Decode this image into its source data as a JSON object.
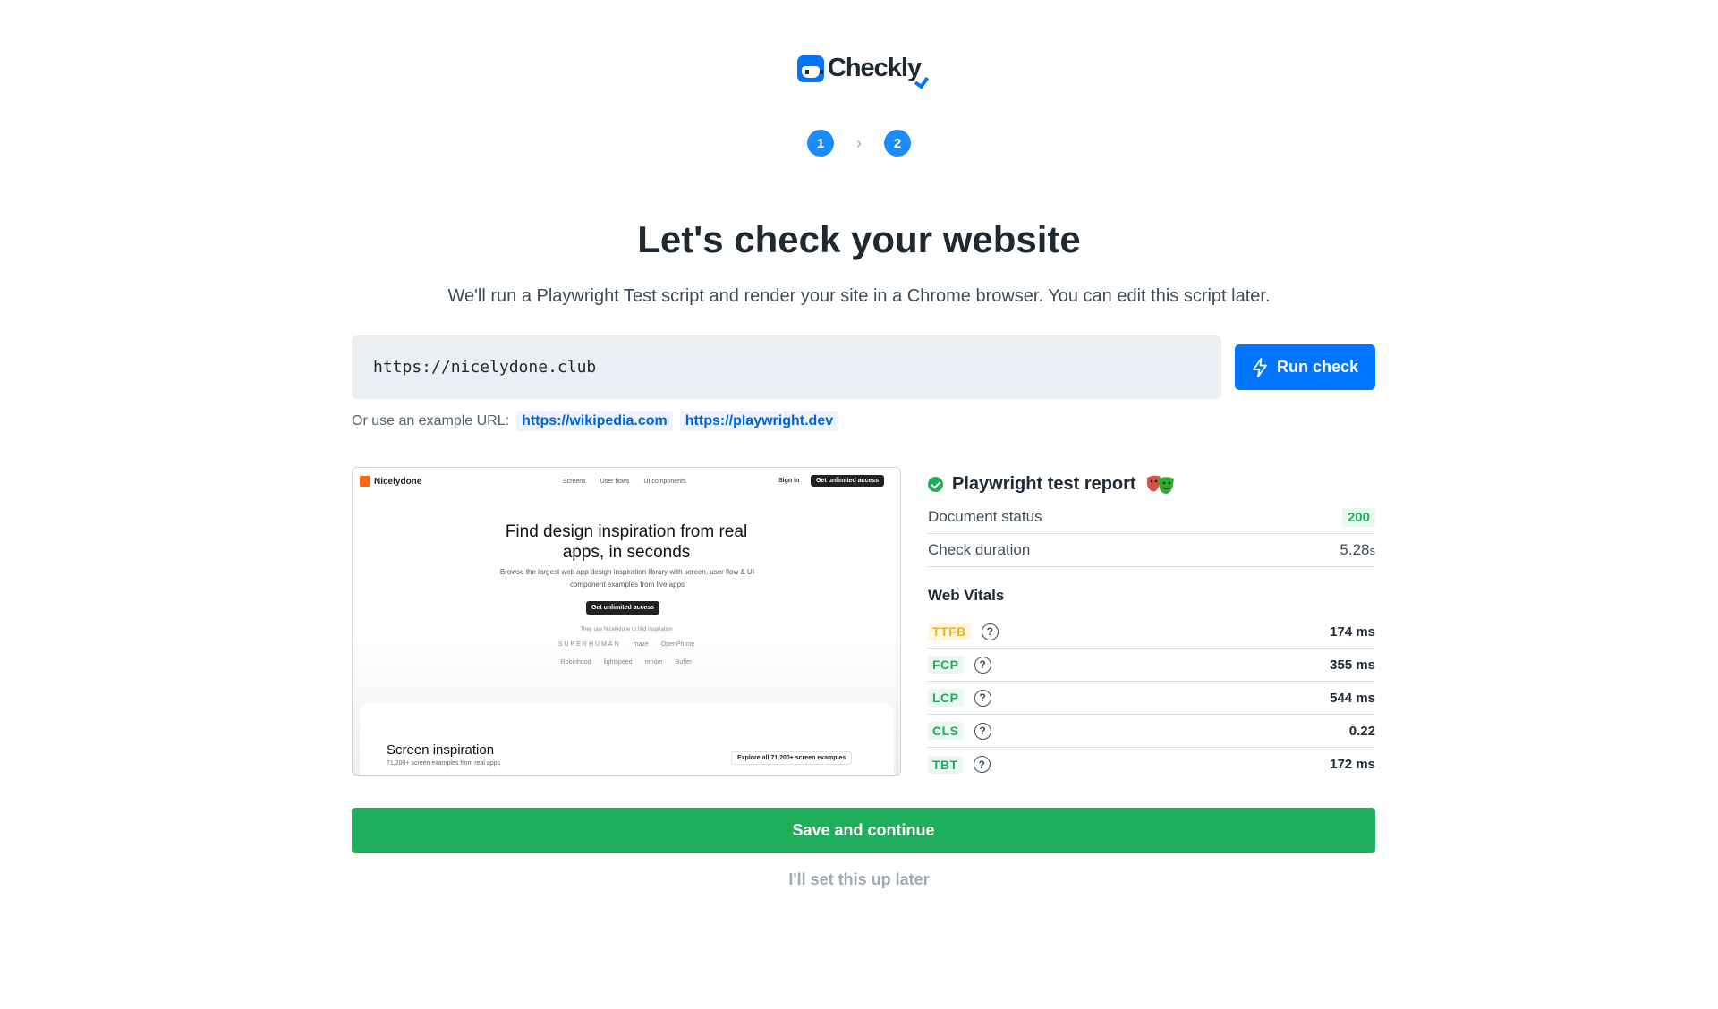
{
  "logo": {
    "text": "Checkly"
  },
  "stepper": {
    "steps": [
      "1",
      "2"
    ],
    "separator": "›"
  },
  "heading": {
    "title": "Let's check your website",
    "subtitle": "We'll run a Playwright Test script and render your site in a Chrome browser. You can edit this script later."
  },
  "url_form": {
    "value": "https://nicelydone.club",
    "run_label": "Run check",
    "examples_label": "Or use an example URL:",
    "examples": [
      "https://wikipedia.com",
      "https://playwright.dev"
    ]
  },
  "preview": {
    "logo": "Nicelydone",
    "nav": [
      "Screens",
      "User flows",
      "UI components"
    ],
    "signin": "Sign in",
    "cta": "Get unlimited access",
    "hero_title_line1": "Find design inspiration from real",
    "hero_title_line2": "apps, in seconds",
    "hero_sub": "Browse the largest web app design inspiration library with screen, user flow & UI component examples from live apps",
    "hero_button": "Get unlimited access",
    "used_by": "They use Nicelydone to find inspiration",
    "brands_row1": [
      "SUPERHUMAN",
      "maze",
      "OpenPhone"
    ],
    "brands_row2": [
      "Robinhood",
      "lightspeed",
      "render",
      "Buffer"
    ],
    "card_title": "Screen inspiration",
    "card_sub": "71,200+ screen examples from real apps",
    "card_button": "Explore all 71,200+ screen examples"
  },
  "report": {
    "title": "Playwright test report",
    "document_status_label": "Document status",
    "document_status_value": "200",
    "check_duration_label": "Check duration",
    "check_duration_value": "5.28",
    "check_duration_unit": "s",
    "web_vitals_title": "Web Vitals",
    "vitals": [
      {
        "name": "TTFB",
        "value": "174 ms",
        "status": "warn"
      },
      {
        "name": "FCP",
        "value": "355 ms",
        "status": "good"
      },
      {
        "name": "LCP",
        "value": "544 ms",
        "status": "good"
      },
      {
        "name": "CLS",
        "value": "0.22",
        "status": "good"
      },
      {
        "name": "TBT",
        "value": "172 ms",
        "status": "good"
      }
    ],
    "help_glyph": "?"
  },
  "actions": {
    "save_label": "Save and continue",
    "later_label": "I'll set this up later"
  },
  "colors": {
    "primary": "#0075ff",
    "success": "#1fae5b",
    "warning": "#f2b01e"
  }
}
